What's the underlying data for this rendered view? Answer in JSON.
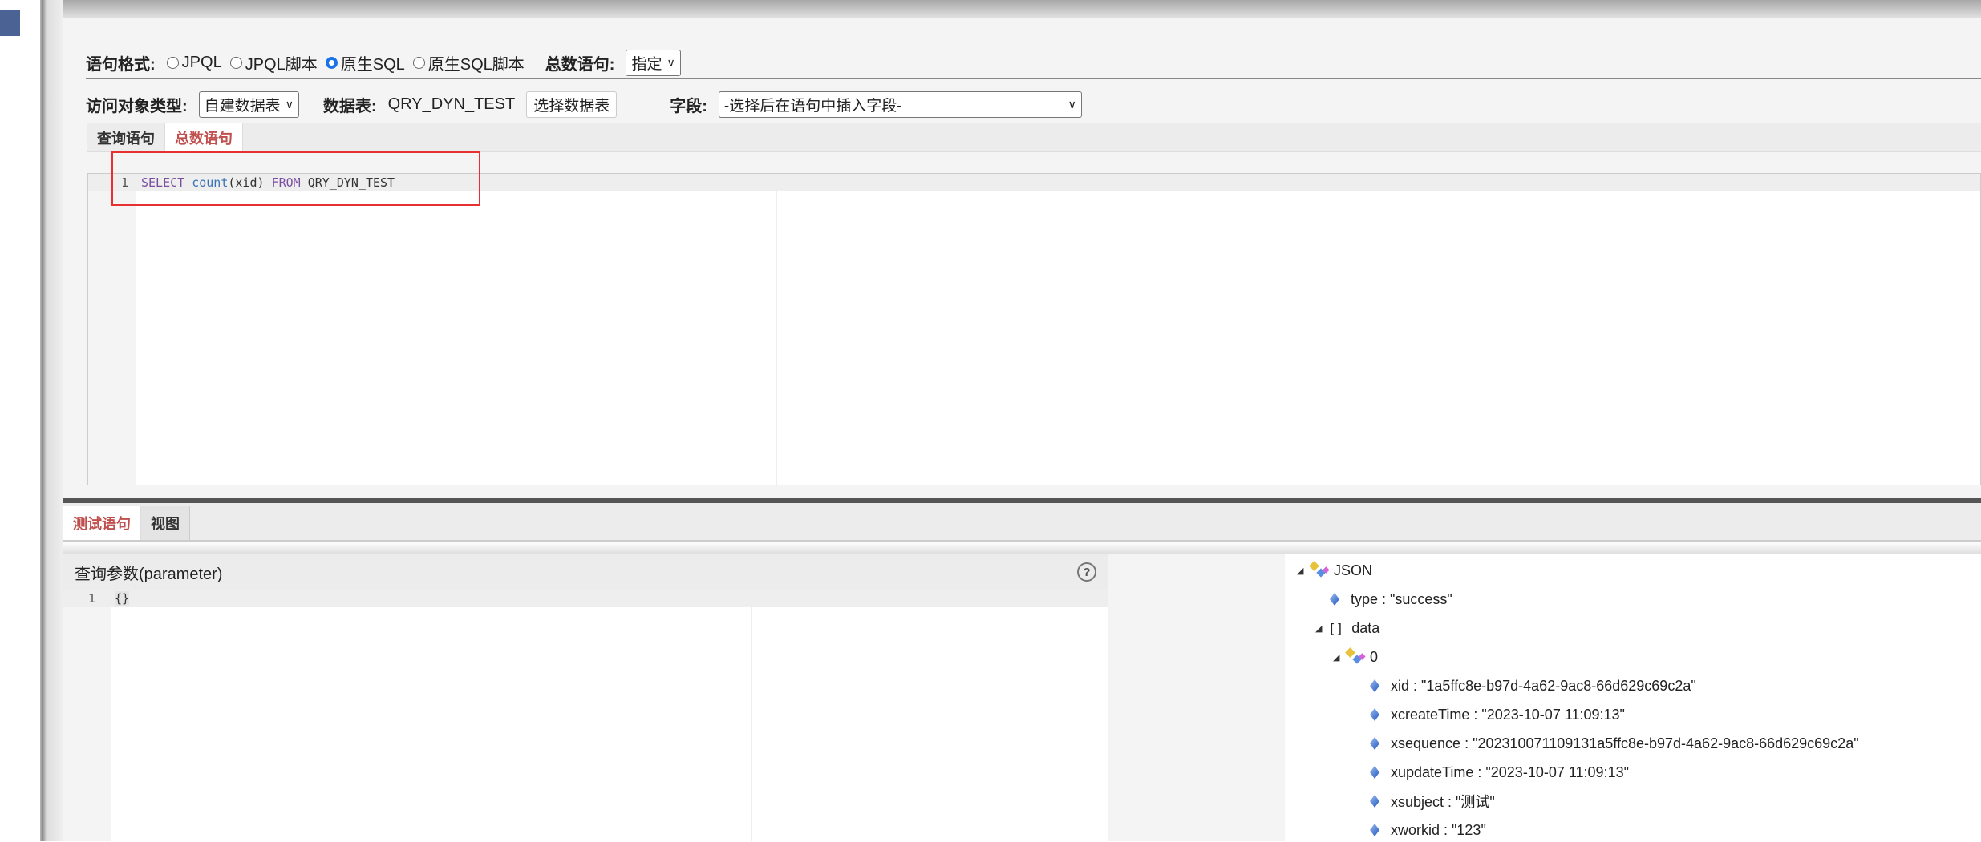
{
  "format_row": {
    "label": "语句格式:",
    "options": [
      "JPQL",
      "JPQL脚本",
      "原生SQL",
      "原生SQL脚本"
    ],
    "selected": "原生SQL",
    "count_label": "总数语句:",
    "count_value": "指定"
  },
  "object_row": {
    "type_label": "访问对象类型:",
    "type_value": "自建数据表",
    "table_label": "数据表:",
    "table_value": "QRY_DYN_TEST",
    "choose_button": "选择数据表",
    "field_label": "字段:",
    "field_value": "-选择后在语句中插入字段-"
  },
  "query_tabs": [
    "查询语句",
    "总数语句"
  ],
  "editor": {
    "line": "1",
    "code": {
      "k1": "SELECT",
      "fn": "count",
      "arg": "(xid)",
      "k2": "FROM",
      "table": "QRY_DYN_TEST"
    }
  },
  "bottom_tabs": [
    "测试语句",
    "视图"
  ],
  "params": {
    "title": "查询参数(parameter)",
    "help": "?",
    "line": "1",
    "code": "{}"
  },
  "tree": {
    "root": "JSON",
    "type": "type : \"success\"",
    "data": "data",
    "index": "0",
    "fields": [
      "xid : \"1a5ffc8e-b97d-4a62-9ac8-66d629c69c2a\"",
      "xcreateTime : \"2023-10-07 11:09:13\"",
      "xsequence : \"202310071109131a5ffc8e-b97d-4a62-9ac8-66d629c69c2a\"",
      "xupdateTime : \"2023-10-07 11:09:13\"",
      "xsubject : \"测试\"",
      "xworkid : \"123\""
    ]
  },
  "colors": {
    "accent": "#c0504d",
    "highlight": "#e83030"
  }
}
